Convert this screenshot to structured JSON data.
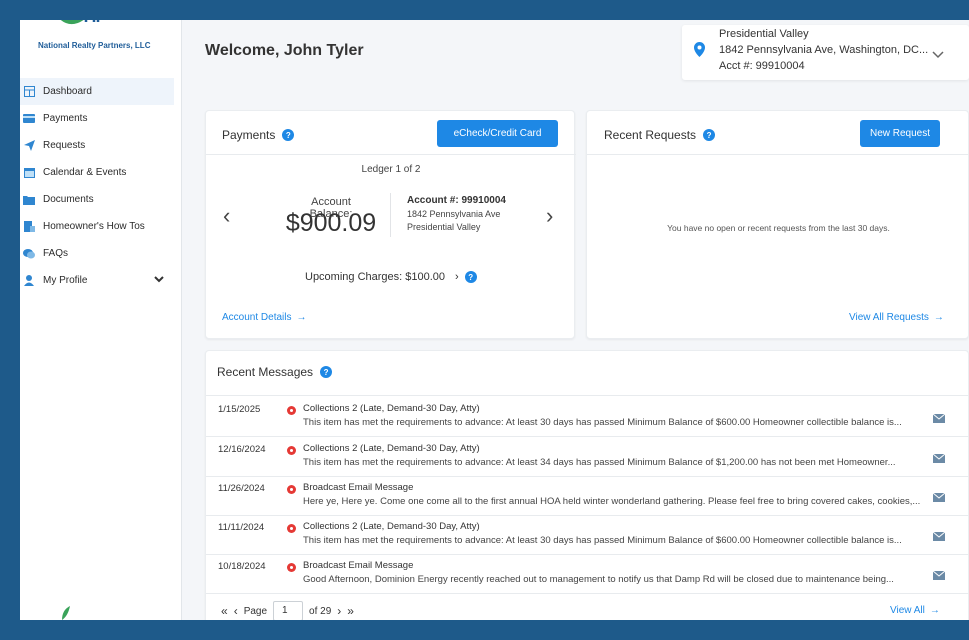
{
  "brand": {
    "company": "National Realty Partners, LLC",
    "logo_text": "nrp",
    "primary_color": "#1e88e5",
    "logo_color": "#1f5d99",
    "leaf_color": "#3aa35a"
  },
  "sidebar": {
    "items": [
      {
        "label": "Dashboard",
        "icon": "dashboard-icon",
        "active": true
      },
      {
        "label": "Payments",
        "icon": "credit-card-icon"
      },
      {
        "label": "Requests",
        "icon": "paper-plane-icon"
      },
      {
        "label": "Calendar & Events",
        "icon": "calendar-icon"
      },
      {
        "label": "Documents",
        "icon": "folder-icon"
      },
      {
        "label": "Homeowner's How Tos",
        "icon": "book-icon"
      },
      {
        "label": "FAQs",
        "icon": "chat-icon"
      },
      {
        "label": "My Profile",
        "icon": "user-icon",
        "expandable": true
      }
    ]
  },
  "header": {
    "welcome": "Welcome, John Tyler"
  },
  "property": {
    "name": "Presidential Valley",
    "address": "1842 Pennsylvania Ave, Washington, DC...",
    "account": "Acct #: 99910004"
  },
  "payments": {
    "title": "Payments",
    "pay_button": "eCheck/Credit Card",
    "ledger": "Ledger 1 of 2",
    "balance_label": "Account Balance:",
    "balance_value": "$900.09",
    "account_number": "Account #: 99910004",
    "address_line1": "1842 Pennsylvania Ave",
    "address_line2": "Presidential Valley",
    "upcoming": "Upcoming Charges: $100.00",
    "details_link": "Account Details"
  },
  "requests": {
    "title": "Recent Requests",
    "new_button": "New Request",
    "empty_text": "You have no open or recent requests from the last 30 days.",
    "view_all": "View All Requests"
  },
  "messages": {
    "title": "Recent Messages",
    "rows": [
      {
        "date": "1/15/2025",
        "title": "Collections 2 (Late, Demand-30 Day, Atty)",
        "body": "This item has met the requirements to advance: At least 30 days has passed Minimum Balance of $600.00 Homeowner collectible balance is..."
      },
      {
        "date": "12/16/2024",
        "title": "Collections 2 (Late, Demand-30 Day, Atty)",
        "body": "This item has met the requirements to advance: At least 34 days has passed Minimum Balance of $1,200.00 has not been met Homeowner..."
      },
      {
        "date": "11/26/2024",
        "title": "Broadcast Email Message",
        "body": "Here ye, Here ye. Come one come all to the first annual HOA held winter wonderland gathering. Please feel free to bring covered cakes, cookies,..."
      },
      {
        "date": "11/11/2024",
        "title": "Collections 2 (Late, Demand-30 Day, Atty)",
        "body": "This item has met the requirements to advance: At least 30 days has passed Minimum Balance of $600.00 Homeowner collectible balance is..."
      },
      {
        "date": "10/18/2024",
        "title": "Broadcast Email Message",
        "body": "Good Afternoon, Dominion Energy recently reached out to management to notify us that Damp Rd will be closed due to maintenance being..."
      }
    ],
    "pager": {
      "page_label": "Page",
      "page_value": "1",
      "of_label": "of 29"
    },
    "view_all": "View All"
  }
}
